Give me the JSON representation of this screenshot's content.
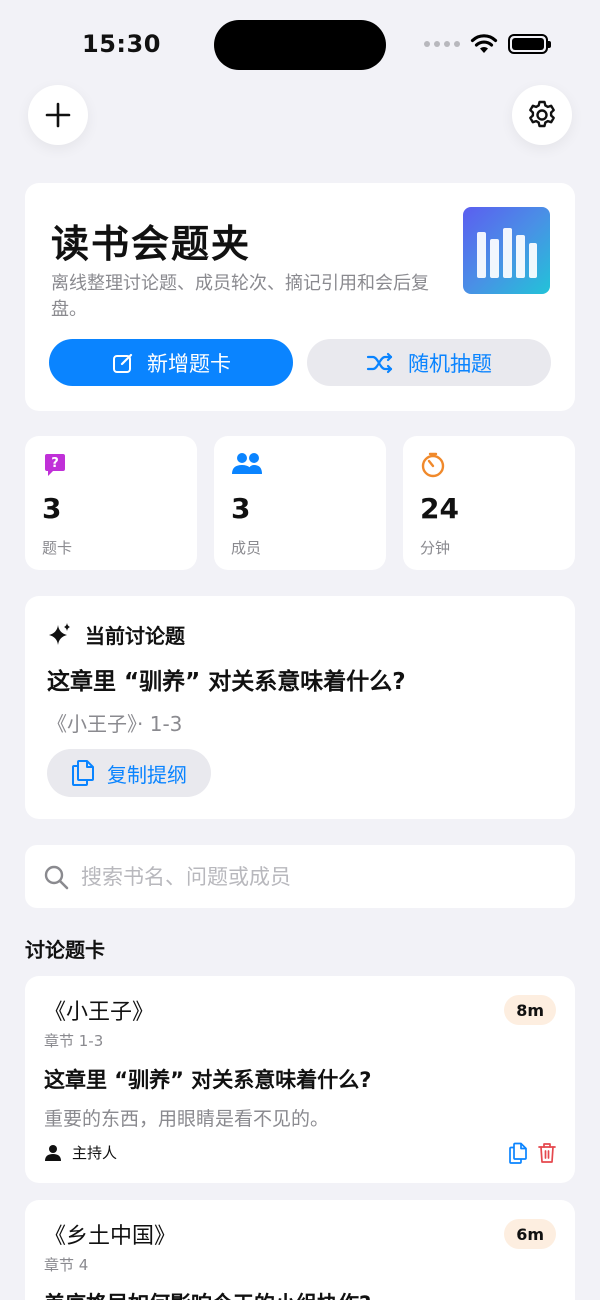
{
  "status_bar": {
    "time": "15:30"
  },
  "hero": {
    "title": "读书会题夹",
    "description": "离线整理讨论题、成员轮次、摘记引用和会后复盘。",
    "primary_button": "新增题卡",
    "secondary_button": "随机抽题"
  },
  "stats": [
    {
      "value": "3",
      "label": "题卡",
      "icon": "question-bubble-icon",
      "color": "#c030d8"
    },
    {
      "value": "3",
      "label": "成员",
      "icon": "people-icon",
      "color": "#0a84ff"
    },
    {
      "value": "24",
      "label": "分钟",
      "icon": "timer-icon",
      "color": "#f0892b"
    }
  ],
  "current": {
    "heading": "当前讨论题",
    "question": "这章里 “驯养” 对关系意味着什么?",
    "meta": "《小王子》· 1-3",
    "copy_button": "复制提纲"
  },
  "search": {
    "placeholder": "搜索书名、问题或成员"
  },
  "list": {
    "title": "讨论题卡",
    "cards": [
      {
        "book": "《小王子》",
        "chapter": "章节 1-3",
        "duration": "8m",
        "question": "这章里 “驯养” 对关系意味着什么?",
        "quote": "重要的东西，用眼睛是看不见的。",
        "role": "主持人"
      },
      {
        "book": "《乡土中国》",
        "chapter": "章节 4",
        "duration": "6m",
        "question": "差序格局如何影响今天的小组协作?"
      }
    ]
  },
  "colors": {
    "accent": "#0a84ff",
    "danger": "#e5484d",
    "background": "#f2f2f7"
  }
}
